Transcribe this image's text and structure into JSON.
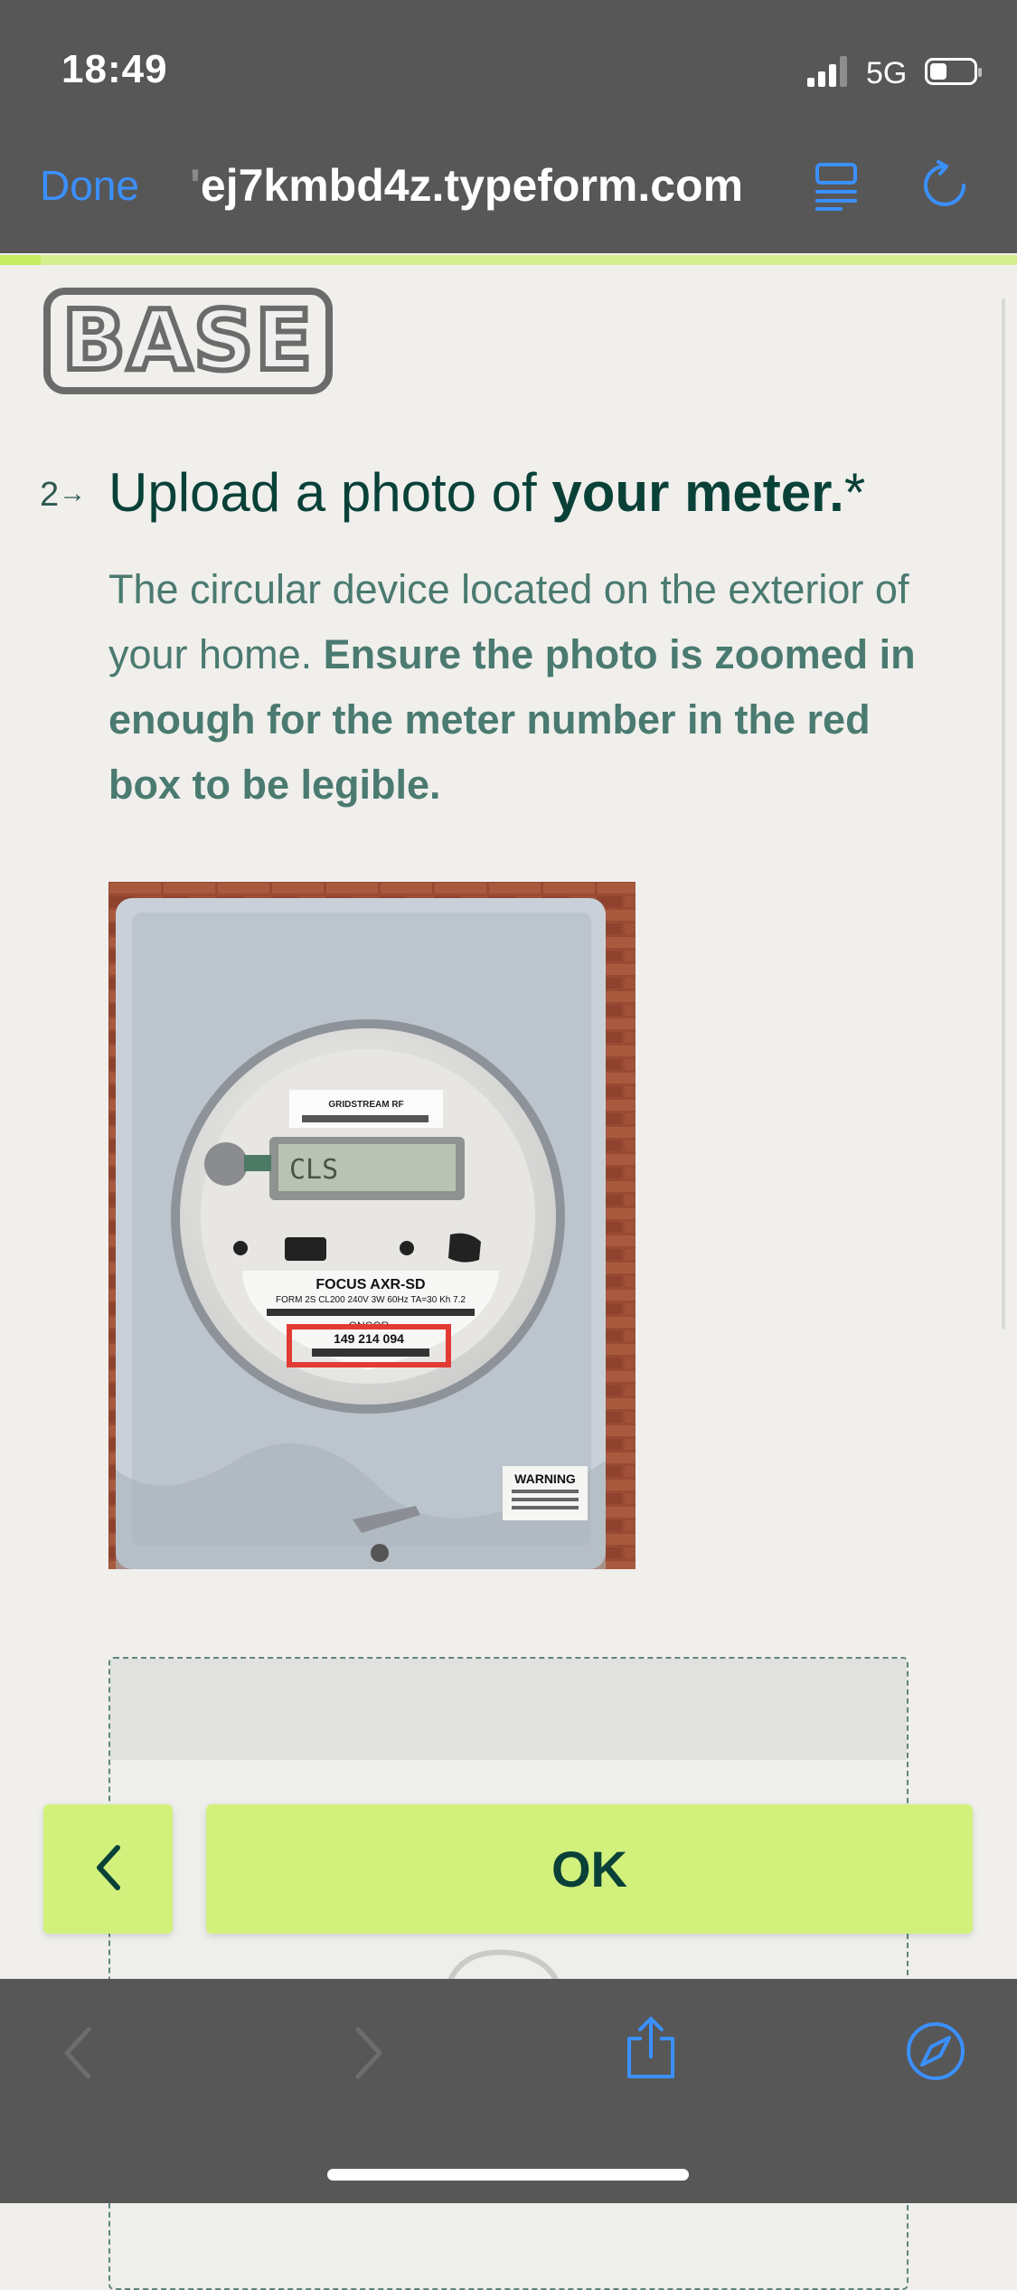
{
  "status_bar": {
    "time": "18:49",
    "network": "5G"
  },
  "browser": {
    "done_label": "Done",
    "url_prefix": "'",
    "url": "ej7kmbd4z.typeform.com",
    "accent_color": "#3b90ff"
  },
  "form": {
    "progress_fraction": 0.04,
    "logo_text": "BASE",
    "question": {
      "number": "2",
      "arrow": "→",
      "title_normal": "Upload a photo of ",
      "title_bold": "your meter.",
      "required_mark": "*",
      "desc_normal": "The circular device located on the exterior of your home. ",
      "desc_bold": "Ensure the photo is zoomed in enough for the meter number in the red box to be legible."
    },
    "meter_image": {
      "brand": "GRIDSTREAM RF",
      "model": "FOCUS  AXR-SD",
      "spec": "FORM 2S CL200 240V 3W 60Hz TA=30 Kh 7.2",
      "display": "CLS",
      "utility": "ONCOR",
      "meter_number": "149 214 094",
      "warning": "WARNING"
    },
    "back_button_icon": "chevron-left-icon",
    "ok_label": "OK",
    "button_color": "#d2f17c",
    "text_color": "#094138"
  },
  "toolbar": {
    "icons": [
      "back-arrow-icon",
      "forward-arrow-icon",
      "share-icon",
      "compass-icon"
    ]
  }
}
